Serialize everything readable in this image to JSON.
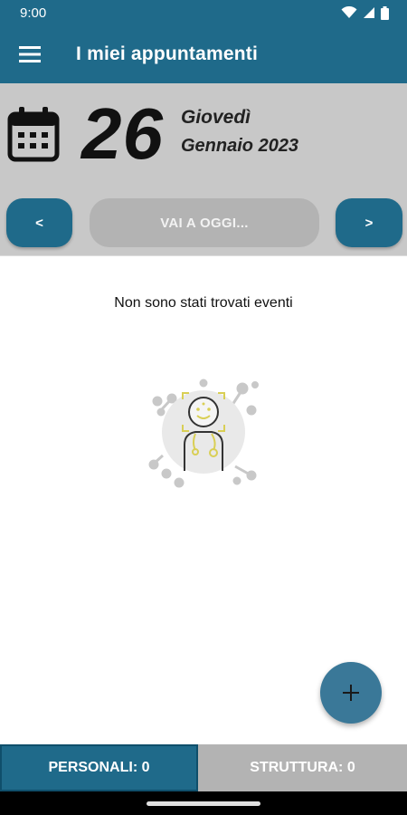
{
  "status": {
    "time": "9:00"
  },
  "header": {
    "title": "I miei appuntamenti",
    "menu_icon": "hamburger-icon"
  },
  "date": {
    "day": "26",
    "weekday": "Giovedì",
    "month_year": "Gennaio 2023",
    "icon": "calendar-icon"
  },
  "nav": {
    "prev_label": "<",
    "today_label": "VAI A OGGI...",
    "next_label": ">"
  },
  "main": {
    "empty_message": "Non sono stati trovati eventi",
    "illustration_icon": "doctor-illustration"
  },
  "fab": {
    "icon": "plus-icon",
    "label": "+"
  },
  "tabs": [
    {
      "label": "PERSONALI: 0",
      "selected": true
    },
    {
      "label": "STRUTTURA: 0",
      "selected": false
    }
  ],
  "colors": {
    "primary": "#1f6a8a",
    "panel": "#c8c8c8",
    "disabled": "#b3b3b3",
    "accent": "#d9cf55"
  }
}
